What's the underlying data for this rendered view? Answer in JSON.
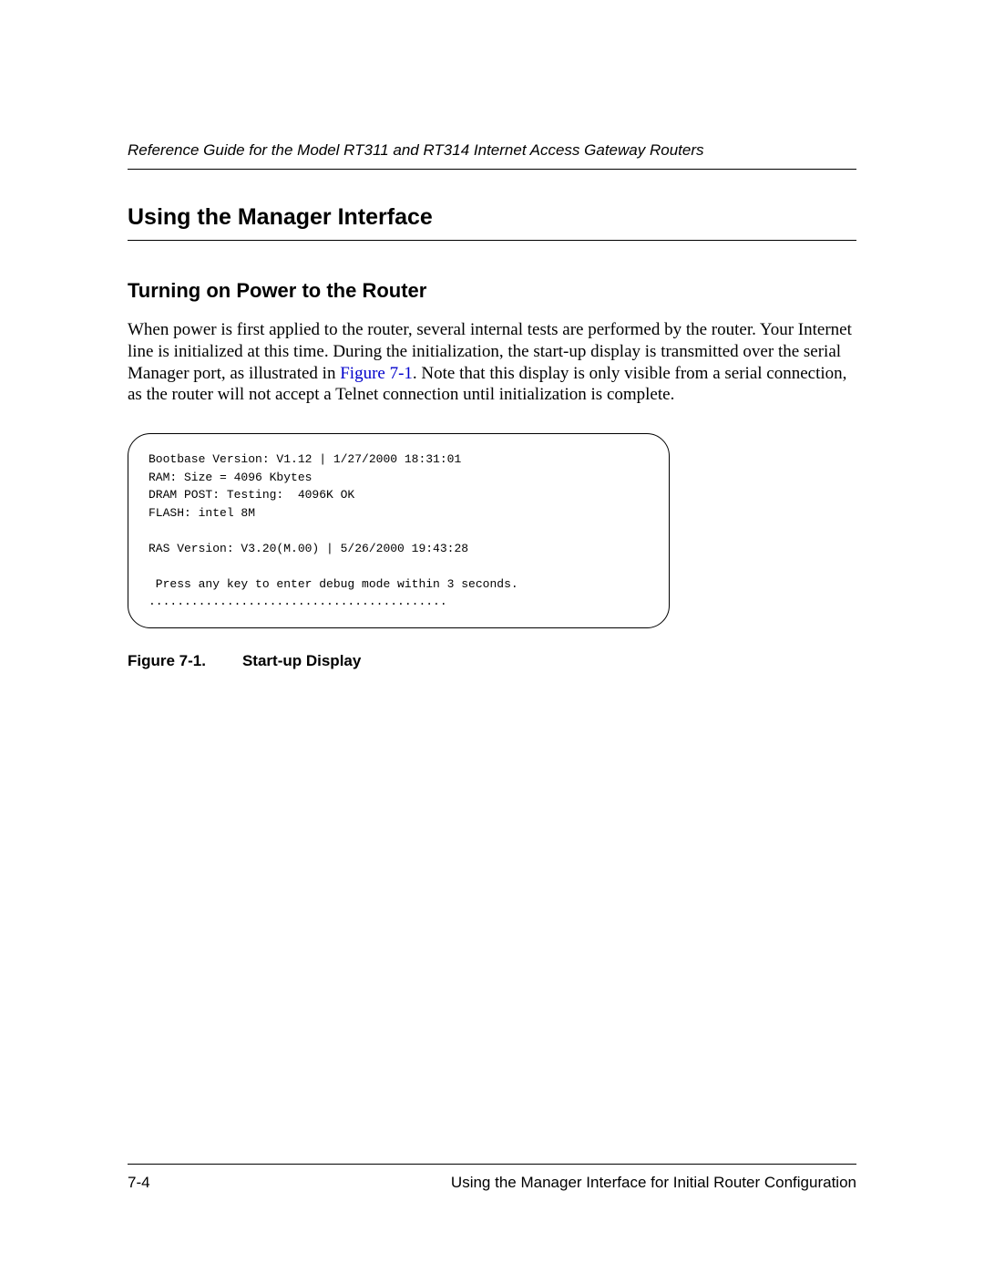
{
  "header": {
    "title": "Reference Guide for the Model RT311 and RT314 Internet Access Gateway Routers"
  },
  "section": {
    "title": "Using the Manager Interface"
  },
  "subsection": {
    "title": "Turning on Power to the Router"
  },
  "body": {
    "text_before_link": "When power is first applied to the router, several internal tests are performed by the router. Your Internet line is initialized at this time. During the initialization, the start-up display is transmitted over the serial Manager port, as illustrated in ",
    "link_text": "Figure 7-1",
    "text_after_link": ". Note that this display is only visible from a serial connection, as the router will not accept a Telnet connection until initialization is complete."
  },
  "code": {
    "content": "Bootbase Version: V1.12 | 1/27/2000 18:31:01\nRAM: Size = 4096 Kbytes\nDRAM POST: Testing:  4096K OK\nFLASH: intel 8M\n\nRAS Version: V3.20(M.00) | 5/26/2000 19:43:28\n\n Press any key to enter debug mode within 3 seconds.\n.........................................."
  },
  "figure": {
    "label": "Figure 7-1.",
    "caption": "Start-up Display"
  },
  "footer": {
    "page_number": "7-4",
    "chapter_title": "Using the Manager Interface for Initial Router Configuration"
  }
}
